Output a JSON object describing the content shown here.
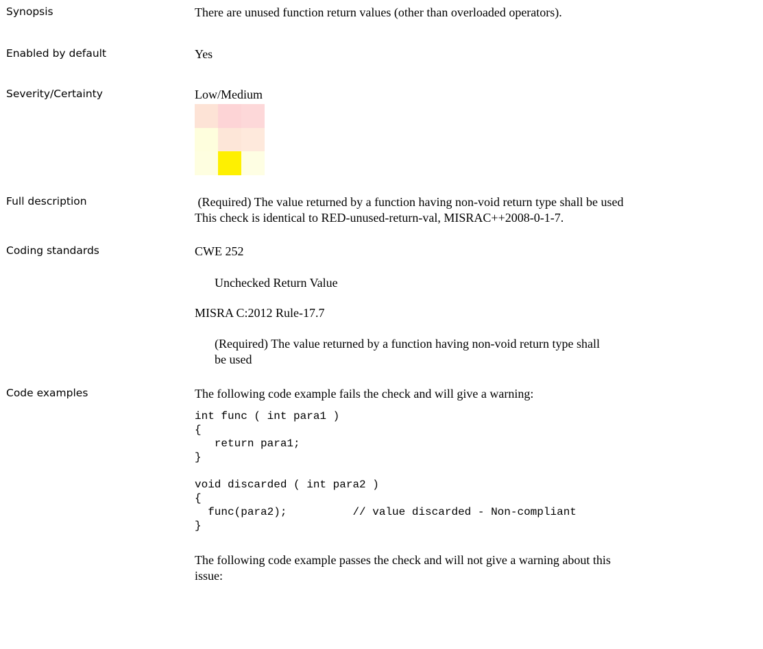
{
  "rows": {
    "synopsis": {
      "label": "Synopsis",
      "text": "There are unused function return values (other than overloaded operators)."
    },
    "enabled": {
      "label": "Enabled by default",
      "text": "Yes"
    },
    "severity": {
      "label": "Severity/Certainty",
      "text": "Low/Medium",
      "matrix_colors": [
        [
          "#fde3d6",
          "#fdd4d6",
          "#fdd8d9"
        ],
        [
          "#fefedd",
          "#fde6d8",
          "#fee9dc"
        ],
        [
          "#fefee0",
          "#fef001",
          "#fefee3"
        ]
      ]
    },
    "full_description": {
      "label": "Full description",
      "line1": " (Required) The value returned by a function having non-void return type shall be used",
      "line2": "This check is identical to RED-unused-return-val, MISRAC++2008-0-1-7."
    },
    "coding_standards": {
      "label": "Coding standards",
      "std1_name": "CWE 252",
      "std1_desc": "Unchecked Return Value",
      "std2_name": "MISRA C:2012 Rule-17.7",
      "std2_desc_line1": "(Required) The value returned by a function having non-void return type shall",
      "std2_desc_line2": "be used"
    },
    "code_examples": {
      "label": "Code examples",
      "fail_intro": "The following code example fails the check and will give a warning:",
      "fail_code": "int func ( int para1 )\n{\n   return para1;\n}\n\nvoid discarded ( int para2 )\n{\n  func(para2);          // value discarded - Non-compliant\n}",
      "pass_intro_line1": "The following code example passes the check and will not give a warning about this",
      "pass_intro_line2": "issue:"
    }
  }
}
